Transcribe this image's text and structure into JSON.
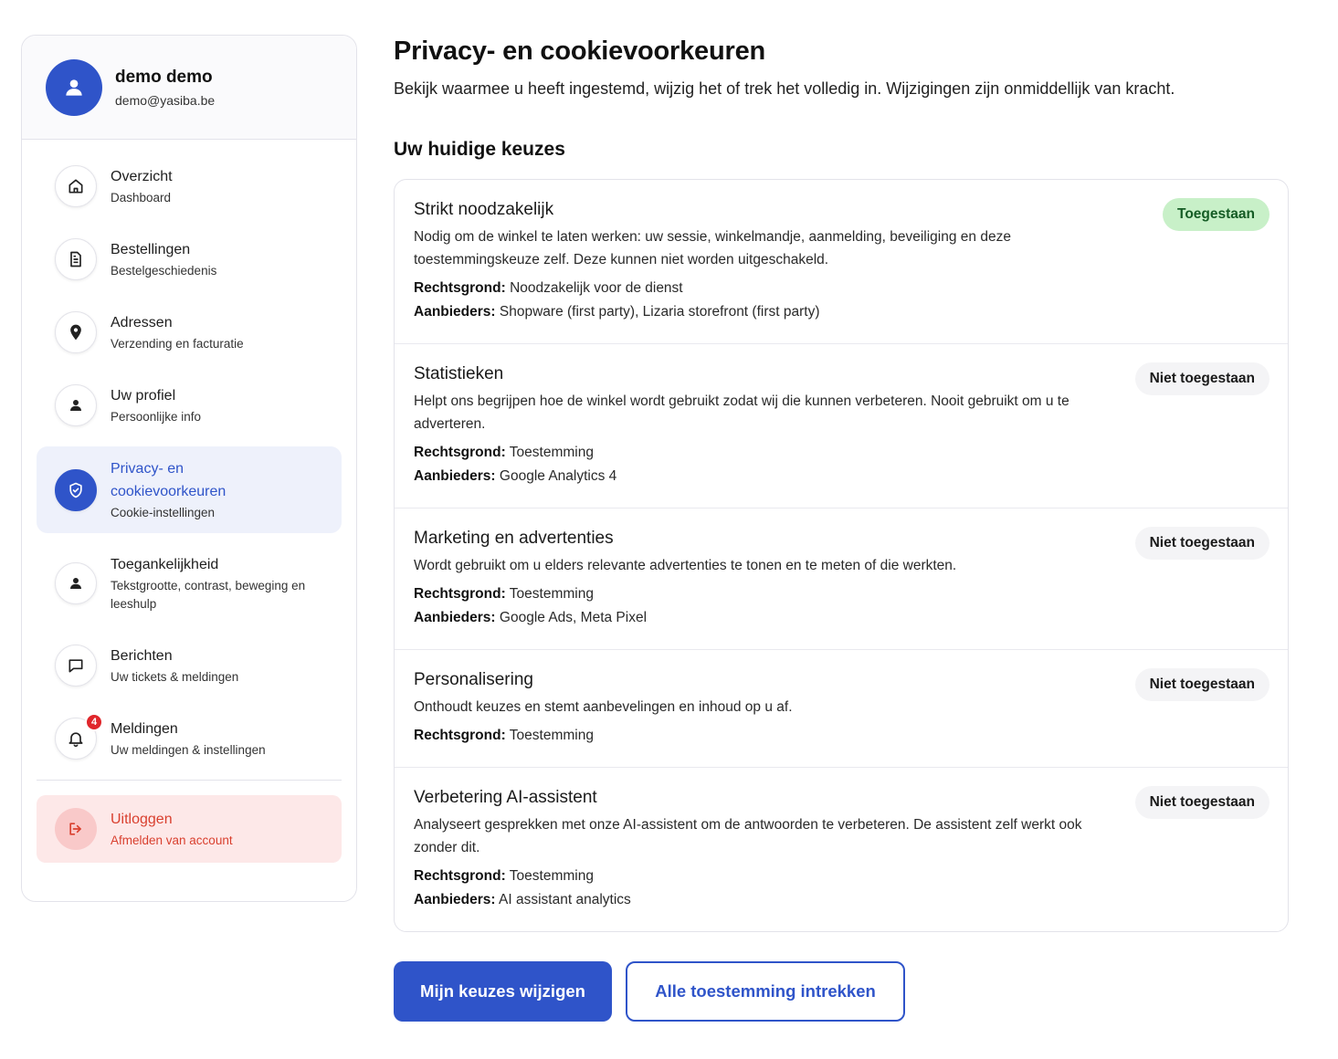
{
  "user": {
    "name": "demo demo",
    "email": "demo@yasiba.be"
  },
  "nav": {
    "overview": {
      "label": "Overzicht",
      "sub": "Dashboard"
    },
    "orders": {
      "label": "Bestellingen",
      "sub": "Bestelgeschiedenis"
    },
    "addresses": {
      "label": "Adressen",
      "sub": "Verzending en facturatie"
    },
    "profile": {
      "label": "Uw profiel",
      "sub": "Persoonlijke info"
    },
    "privacy": {
      "label": "Privacy- en cookievoorkeuren",
      "sub": "Cookie-instellingen"
    },
    "accessibility": {
      "label": "Toegankelijkheid",
      "sub": "Tekstgrootte, contrast, beweging en leeshulp"
    },
    "messages": {
      "label": "Berichten",
      "sub": "Uw tickets & meldingen"
    },
    "notifications": {
      "label": "Meldingen",
      "sub": "Uw meldingen & instellingen",
      "badge": "4"
    },
    "logout": {
      "label": "Uitloggen",
      "sub": "Afmelden van account"
    }
  },
  "main": {
    "title": "Privacy- en cookievoorkeuren",
    "description": "Bekijk waarmee u heeft ingestemd, wijzig het of trek het volledig in. Wijzigingen zijn onmiddellijk van kracht.",
    "section_title": "Uw huidige keuzes",
    "legal_basis_label": "Rechtsgrond:",
    "providers_label": "Aanbieders:",
    "categories": [
      {
        "title": "Strikt noodzakelijk",
        "description": "Nodig om de winkel te laten werken: uw sessie, winkelmandje, aanmelding, beveiliging en deze toestemmingskeuze zelf. Deze kunnen niet worden uitgeschakeld.",
        "legal_basis": "Noodzakelijk voor de dienst",
        "providers": "Shopware (first party), Lizaria storefront (first party)",
        "status": "Toegestaan"
      },
      {
        "title": "Statistieken",
        "description": "Helpt ons begrijpen hoe de winkel wordt gebruikt zodat wij die kunnen verbeteren. Nooit gebruikt om u te adverteren.",
        "legal_basis": "Toestemming",
        "providers": "Google Analytics 4",
        "status": "Niet toegestaan"
      },
      {
        "title": "Marketing en advertenties",
        "description": "Wordt gebruikt om u elders relevante advertenties te tonen en te meten of die werkten.",
        "legal_basis": "Toestemming",
        "providers": "Google Ads, Meta Pixel",
        "status": "Niet toegestaan"
      },
      {
        "title": "Personalisering",
        "description": "Onthoudt keuzes en stemt aanbevelingen en inhoud op u af.",
        "legal_basis": "Toestemming",
        "status": "Niet toegestaan"
      },
      {
        "title": "Verbetering AI-assistent",
        "description": "Analyseert gesprekken met onze AI-assistent om de antwoorden te verbeteren. De assistent zelf werkt ook zonder dit.",
        "legal_basis": "Toestemming",
        "providers": "AI assistant analytics",
        "status": "Niet toegestaan"
      }
    ],
    "buttons": {
      "change": "Mijn keuzes wijzigen",
      "revoke": "Alle toestemming intrekken"
    }
  },
  "colors": {
    "primary": "#2f54c9",
    "allowed_bg": "#c8f0c8",
    "allowed_text": "#155c25",
    "logout_bg": "#fde8e8",
    "logout_text": "#d9402f",
    "badge": "#e0262b"
  },
  "icons": {
    "overview": "home-icon",
    "orders": "document-icon",
    "addresses": "map-pin-icon",
    "profile": "user-icon",
    "privacy": "shield-check-icon",
    "accessibility": "user-icon",
    "messages": "chat-bubble-icon",
    "notifications": "bell-icon",
    "logout": "logout-icon"
  }
}
